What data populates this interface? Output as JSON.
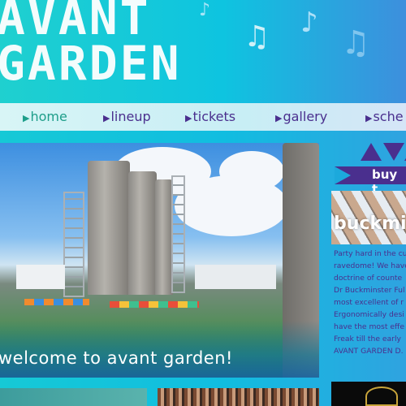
{
  "header": {
    "logo_text": "AVANT GARDEN"
  },
  "nav": {
    "items": [
      {
        "label": "home",
        "active": true
      },
      {
        "label": "lineup"
      },
      {
        "label": "tickets"
      },
      {
        "label": "gallery"
      },
      {
        "label": "sche"
      }
    ]
  },
  "hero": {
    "caption": "welcome to avant garden!"
  },
  "sidebar": {
    "social": [
      "twitter-icon",
      "youtube-icon"
    ],
    "buy_label": "buy t",
    "feature_title": "buckmi",
    "description_lines": [
      "Party hard in the cu",
      "ravedome! We have",
      "doctrine of counte",
      "Dr Buckminster Ful",
      "most excellent of r",
      "Ergonomically desi",
      "have the most effe",
      "Freak till the early",
      "AVANT GARDEN D."
    ]
  },
  "colors": {
    "accent": "#4a2f8e",
    "active": "#1e9e8a",
    "nav_bg": "#d8f5f6"
  }
}
